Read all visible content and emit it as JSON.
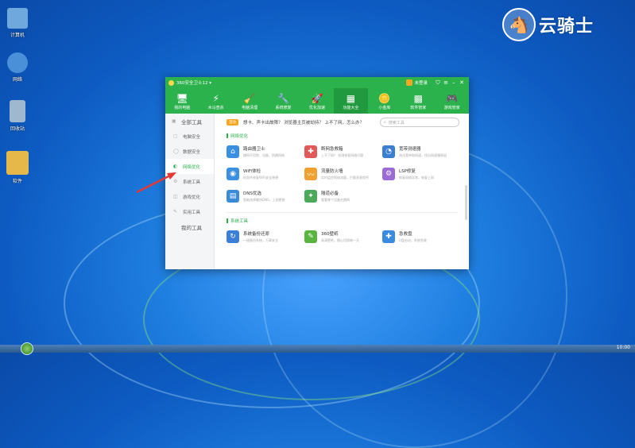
{
  "desktop": {
    "icons": [
      {
        "label": "计算机",
        "color": "#6fa8dc"
      },
      {
        "label": "网络",
        "color": "#4a90d9"
      },
      {
        "label": "回收站",
        "color": "#9fb7cf"
      },
      {
        "label": "软件",
        "color": "#e6b84a"
      }
    ],
    "watermark": {
      "logo": "🐴",
      "text": "云骑士"
    }
  },
  "window": {
    "title": "360安全卫士12 ▾",
    "user": "未登录",
    "controls": [
      "⛉",
      "≡",
      "–",
      "✕"
    ],
    "tabs": [
      {
        "label": "我的电脑",
        "icon": "🖥"
      },
      {
        "label": "木马查杀",
        "icon": "⚡"
      },
      {
        "label": "电脑清理",
        "icon": "🧹"
      },
      {
        "label": "系统修复",
        "icon": "🔧"
      },
      {
        "label": "优化加速",
        "icon": "🚀"
      },
      {
        "label": "功能大全",
        "icon": "▦"
      },
      {
        "label": "小金库",
        "icon": "🪙"
      },
      {
        "label": "软件管家",
        "icon": "▩"
      },
      {
        "label": "游戏管家",
        "icon": "🎮"
      }
    ],
    "sidebar": [
      {
        "label": "全部工具",
        "icon": "▣"
      },
      {
        "label": "电脑安全",
        "icon": "▢"
      },
      {
        "label": "数据安全",
        "icon": "◯"
      },
      {
        "label": "网络优化",
        "icon": "◐"
      },
      {
        "label": "系统工具",
        "icon": "⚙"
      },
      {
        "label": "游戏优化",
        "icon": "◫"
      },
      {
        "label": "实用工具",
        "icon": "✎"
      },
      {
        "label": "我的工具",
        "icon": ""
      }
    ],
    "notice": {
      "badge": "活动",
      "text": "想卡、声卡出故障？ 浏览器主页被劫持？ 上不了网，怎么办？",
      "search_placeholder": "搜索工具"
    },
    "sections": [
      {
        "title": "网络优化",
        "items": [
          {
            "name": "路由器卫士",
            "desc": "蹭网不用愁、设备、防蹭网络",
            "color": "#3b8fe0",
            "icon": "⌂"
          },
          {
            "name": "断网急救箱",
            "desc": "上不了网？ 检测修复网络问题",
            "color": "#e05a5a",
            "icon": "✚"
          },
          {
            "name": "宽带测速器",
            "desc": "测试宽带和网速，找出网速慢原因",
            "color": "#3a7fd0",
            "icon": "◔"
          },
          {
            "name": "WiFi体检",
            "desc": "检测并修复WiFi安全隐患",
            "color": "#3b8fe0",
            "icon": "◉"
          },
          {
            "name": "流量防火墙",
            "desc": "实时监控网络流量，拦截恶意程序",
            "color": "#f0a030",
            "icon": "〰"
          },
          {
            "name": "LSP修复",
            "desc": "修复网络异常，恢复上网",
            "color": "#9b6bd6",
            "icon": "⚙"
          },
          {
            "name": "DNS优选",
            "desc": "智能选择最快DNS，上网更稳",
            "color": "#3a8ad8",
            "icon": "▤"
          },
          {
            "name": "隧道必备",
            "desc": "看看哪个设备在蹭网",
            "color": "#4aaa5a",
            "icon": "✦"
          }
        ]
      },
      {
        "title": "系统工具",
        "items": [
          {
            "name": "系统备份还原",
            "desc": "一键备份系统，万事安全",
            "color": "#3b7fd8",
            "icon": "↻"
          },
          {
            "name": "360壁纸",
            "desc": "高清壁纸，随心切换每一天",
            "color": "#5ab540",
            "icon": "✎"
          },
          {
            "name": "急救盘",
            "desc": "U盘启动，系统急救",
            "color": "#3a8ae0",
            "icon": "✚"
          }
        ]
      }
    ]
  },
  "taskbar": {
    "clock": "10:00"
  }
}
